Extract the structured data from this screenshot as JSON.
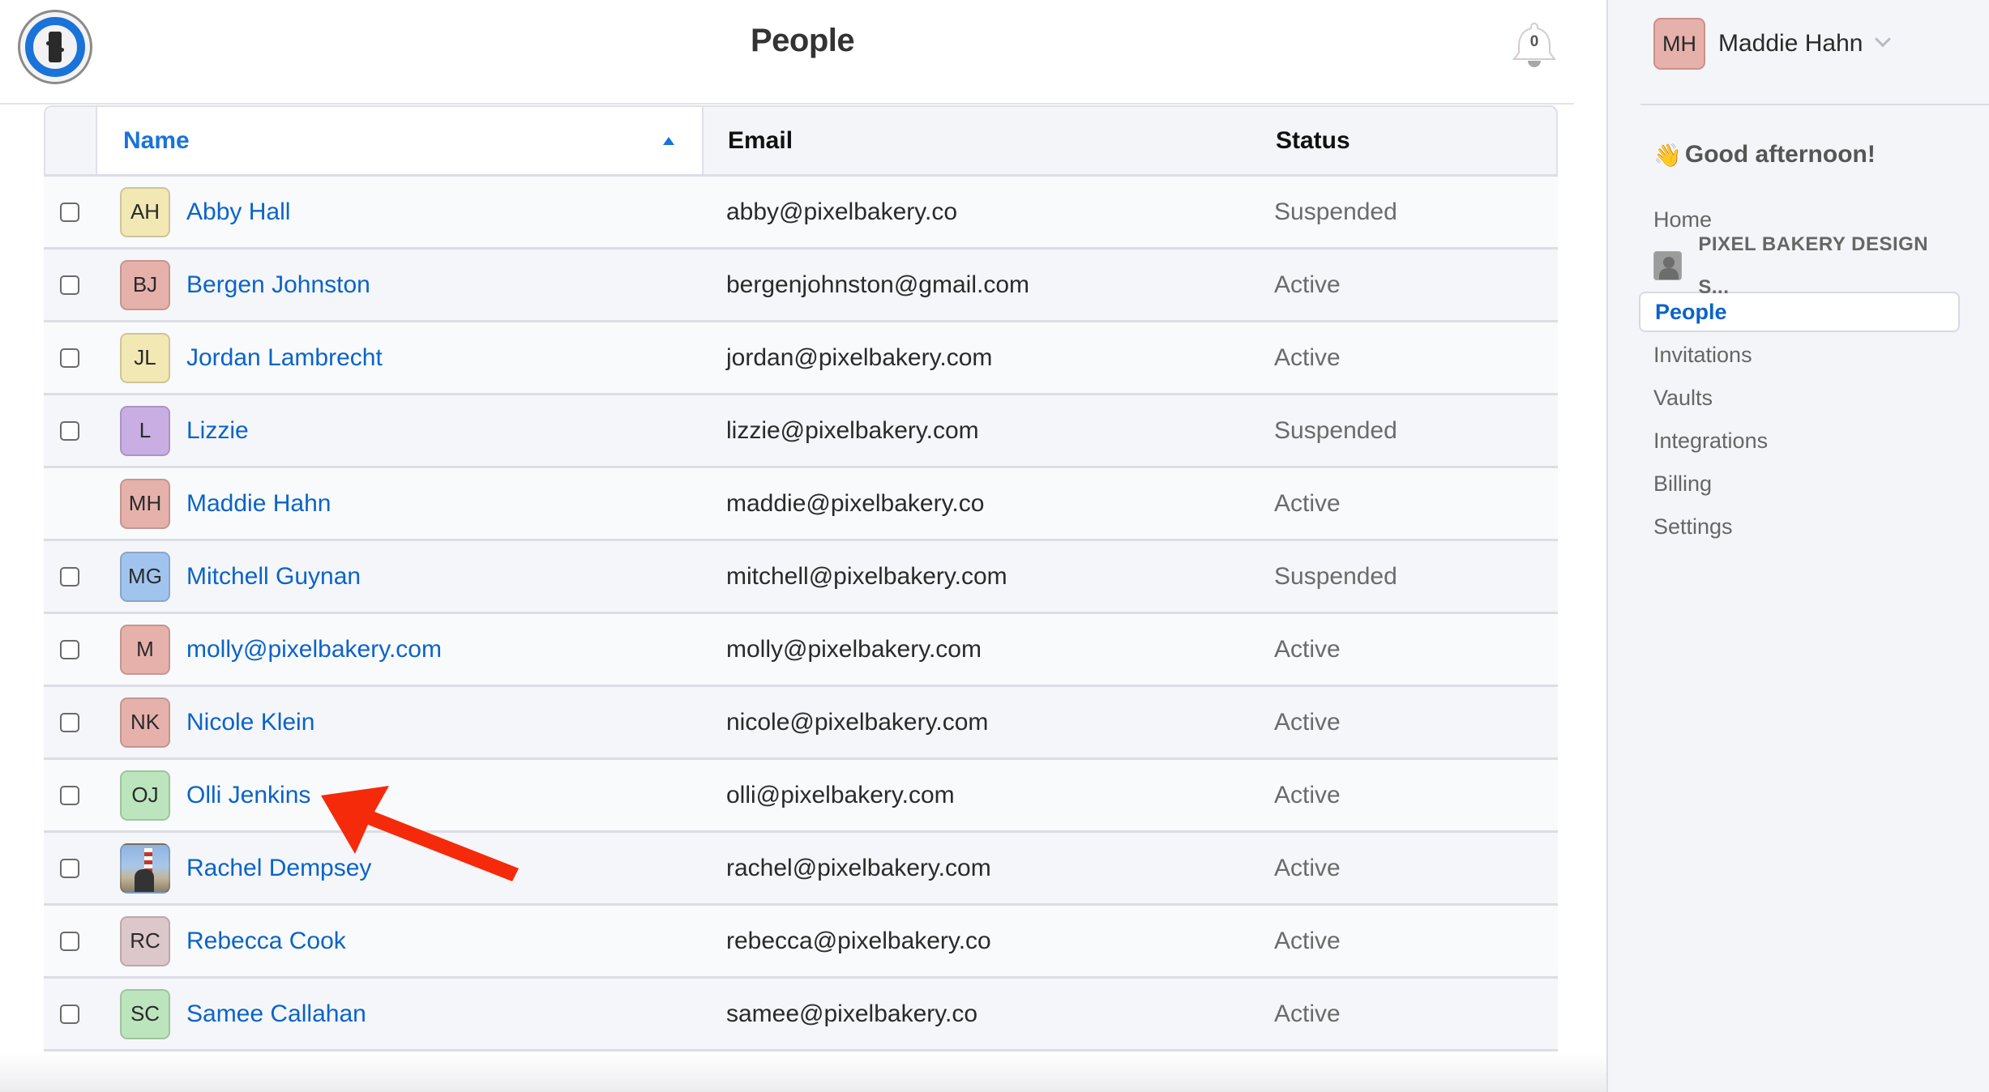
{
  "header": {
    "title": "People",
    "notification_count": "0"
  },
  "table": {
    "columns": {
      "name": "Name",
      "email": "Email",
      "status": "Status"
    },
    "sort": {
      "column": "name",
      "direction": "ascending"
    },
    "rows": [
      {
        "initials": "AH",
        "name": "Abby Hall",
        "email": "abby@pixelbakery.co",
        "status": "Suspended",
        "avatar_color": "#f2e8b4",
        "has_checkbox": true
      },
      {
        "initials": "BJ",
        "name": "Bergen Johnston",
        "email": "bergenjohnston@gmail.com",
        "status": "Active",
        "avatar_color": "#e6b1ab",
        "has_checkbox": true
      },
      {
        "initials": "JL",
        "name": "Jordan Lambrecht",
        "email": "jordan@pixelbakery.com",
        "status": "Active",
        "avatar_color": "#f2e8b4",
        "has_checkbox": true
      },
      {
        "initials": "L",
        "name": "Lizzie",
        "email": "lizzie@pixelbakery.com",
        "status": "Suspended",
        "avatar_color": "#c9aee3",
        "has_checkbox": true
      },
      {
        "initials": "MH",
        "name": "Maddie Hahn",
        "email": "maddie@pixelbakery.co",
        "status": "Active",
        "avatar_color": "#e6b1ab",
        "has_checkbox": false
      },
      {
        "initials": "MG",
        "name": "Mitchell Guynan",
        "email": "mitchell@pixelbakery.com",
        "status": "Suspended",
        "avatar_color": "#a1c4ee",
        "has_checkbox": true
      },
      {
        "initials": "M",
        "name": "molly@pixelbakery.com",
        "email": "molly@pixelbakery.com",
        "status": "Active",
        "avatar_color": "#e6b1ab",
        "has_checkbox": true
      },
      {
        "initials": "NK",
        "name": "Nicole Klein",
        "email": "nicole@pixelbakery.com",
        "status": "Active",
        "avatar_color": "#e6b1ab",
        "has_checkbox": true
      },
      {
        "initials": "OJ",
        "name": "Olli Jenkins",
        "email": "olli@pixelbakery.com",
        "status": "Active",
        "avatar_color": "#bce5bd",
        "has_checkbox": true
      },
      {
        "initials": "",
        "name": "Rachel Dempsey",
        "email": "rachel@pixelbakery.com",
        "status": "Active",
        "avatar_color": "photo",
        "has_checkbox": true
      },
      {
        "initials": "RC",
        "name": "Rebecca Cook",
        "email": "rebecca@pixelbakery.co",
        "status": "Active",
        "avatar_color": "#dcc7cb",
        "has_checkbox": true
      },
      {
        "initials": "SC",
        "name": "Samee Callahan",
        "email": "samee@pixelbakery.co",
        "status": "Active",
        "avatar_color": "#bce5bd",
        "has_checkbox": true
      }
    ]
  },
  "sidebar": {
    "user": {
      "initials": "MH",
      "name": "Maddie Hahn"
    },
    "greeting_emoji": "👋",
    "greeting": "Good afternoon!",
    "nav": [
      {
        "label": "Home",
        "type": "link"
      },
      {
        "label": "PIXEL BAKERY DESIGN S...",
        "type": "org"
      },
      {
        "label": "People",
        "type": "link",
        "active": true
      },
      {
        "label": "Invitations",
        "type": "link"
      },
      {
        "label": "Vaults",
        "type": "link"
      },
      {
        "label": "Integrations",
        "type": "link"
      },
      {
        "label": "Billing",
        "type": "link"
      },
      {
        "label": "Settings",
        "type": "link"
      }
    ]
  },
  "annotation": {
    "type": "red-arrow",
    "target": "Olli Jenkins",
    "color": "#f52a0a"
  },
  "colors": {
    "accent": "#1a73d9",
    "link": "#0a64c8",
    "sidebar_bg": "#f4f5f9"
  }
}
